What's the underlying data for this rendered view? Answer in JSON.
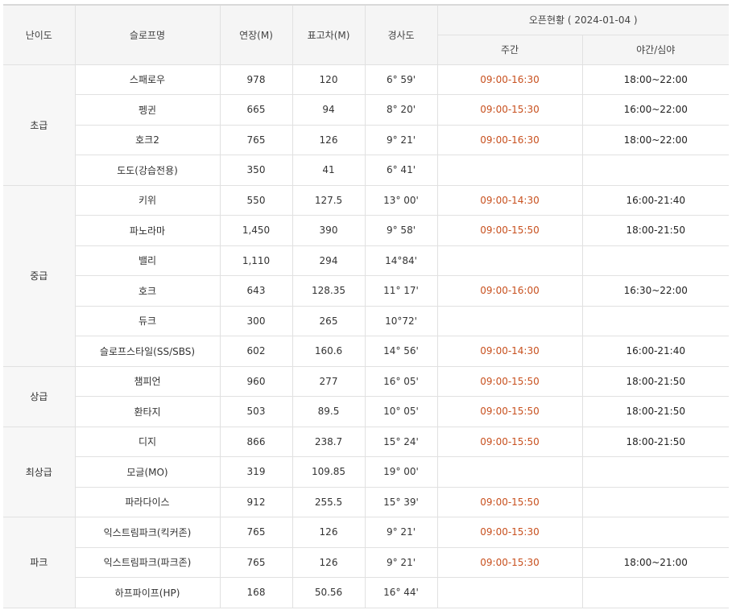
{
  "headers": {
    "level": "난이도",
    "name": "슬로프명",
    "length": "연장(M)",
    "elev": "표고차(M)",
    "slope": "경사도",
    "open": "오픈현황 ( 2024-01-04 )",
    "day": "주간",
    "night": "야간/심야"
  },
  "groups": [
    {
      "level": "초급",
      "rows": [
        {
          "name": "스패로우",
          "length": "978",
          "elev": "120",
          "slope": "6° 59'",
          "day": "09:00-16:30",
          "night": "18:00~22:00"
        },
        {
          "name": "펭귄",
          "length": "665",
          "elev": "94",
          "slope": "8° 20'",
          "day": "09:00-15:30",
          "night": "16:00~22:00"
        },
        {
          "name": "호크2",
          "length": "765",
          "elev": "126",
          "slope": "9° 21'",
          "day": "09:00-16:30",
          "night": "18:00~22:00"
        },
        {
          "name": "도도(강습전용)",
          "length": "350",
          "elev": "41",
          "slope": "6° 41'",
          "day": "",
          "night": ""
        }
      ]
    },
    {
      "level": "중급",
      "rows": [
        {
          "name": "키위",
          "length": "550",
          "elev": "127.5",
          "slope": "13° 00'",
          "day": "09:00-14:30",
          "night": "16:00-21:40"
        },
        {
          "name": "파노라마",
          "length": "1,450",
          "elev": "390",
          "slope": "9° 58'",
          "day": "09:00-15:50",
          "night": "18:00-21:50"
        },
        {
          "name": "밸리",
          "length": "1,110",
          "elev": "294",
          "slope": "14°84'",
          "day": "",
          "night": ""
        },
        {
          "name": "호크",
          "length": "643",
          "elev": "128.35",
          "slope": "11° 17'",
          "day": "09:00-16:00",
          "night": "16:30~22:00"
        },
        {
          "name": "듀크",
          "length": "300",
          "elev": "265",
          "slope": "10°72'",
          "day": "",
          "night": ""
        },
        {
          "name": "슬로프스타일(SS/SBS)",
          "length": "602",
          "elev": "160.6",
          "slope": "14° 56'",
          "day": "09:00-14:30",
          "night": "16:00-21:40"
        }
      ]
    },
    {
      "level": "상급",
      "rows": [
        {
          "name": "챔피언",
          "length": "960",
          "elev": "277",
          "slope": "16° 05'",
          "day": "09:00-15:50",
          "night": "18:00-21:50"
        },
        {
          "name": "환타지",
          "length": "503",
          "elev": "89.5",
          "slope": "10° 05'",
          "day": "09:00-15:50",
          "night": "18:00-21:50"
        }
      ]
    },
    {
      "level": "최상급",
      "rows": [
        {
          "name": "디지",
          "length": "866",
          "elev": "238.7",
          "slope": "15° 24'",
          "day": "09:00-15:50",
          "night": "18:00-21:50"
        },
        {
          "name": "모글(MO)",
          "length": "319",
          "elev": "109.85",
          "slope": "19° 00'",
          "day": "",
          "night": ""
        },
        {
          "name": "파라다이스",
          "length": "912",
          "elev": "255.5",
          "slope": "15° 39'",
          "day": "09:00-15:50",
          "night": ""
        }
      ]
    },
    {
      "level": "파크",
      "rows": [
        {
          "name": "익스트림파크(킥커존)",
          "length": "765",
          "elev": "126",
          "slope": "9° 21'",
          "day": "09:00-15:30",
          "night": ""
        },
        {
          "name": "익스트림파크(파크존)",
          "length": "765",
          "elev": "126",
          "slope": "9° 21'",
          "day": "09:00-15:30",
          "night": "18:00~21:00"
        },
        {
          "name": "하프파이프(HP)",
          "length": "168",
          "elev": "50.56",
          "slope": "16° 44'",
          "day": "",
          "night": ""
        }
      ]
    }
  ]
}
